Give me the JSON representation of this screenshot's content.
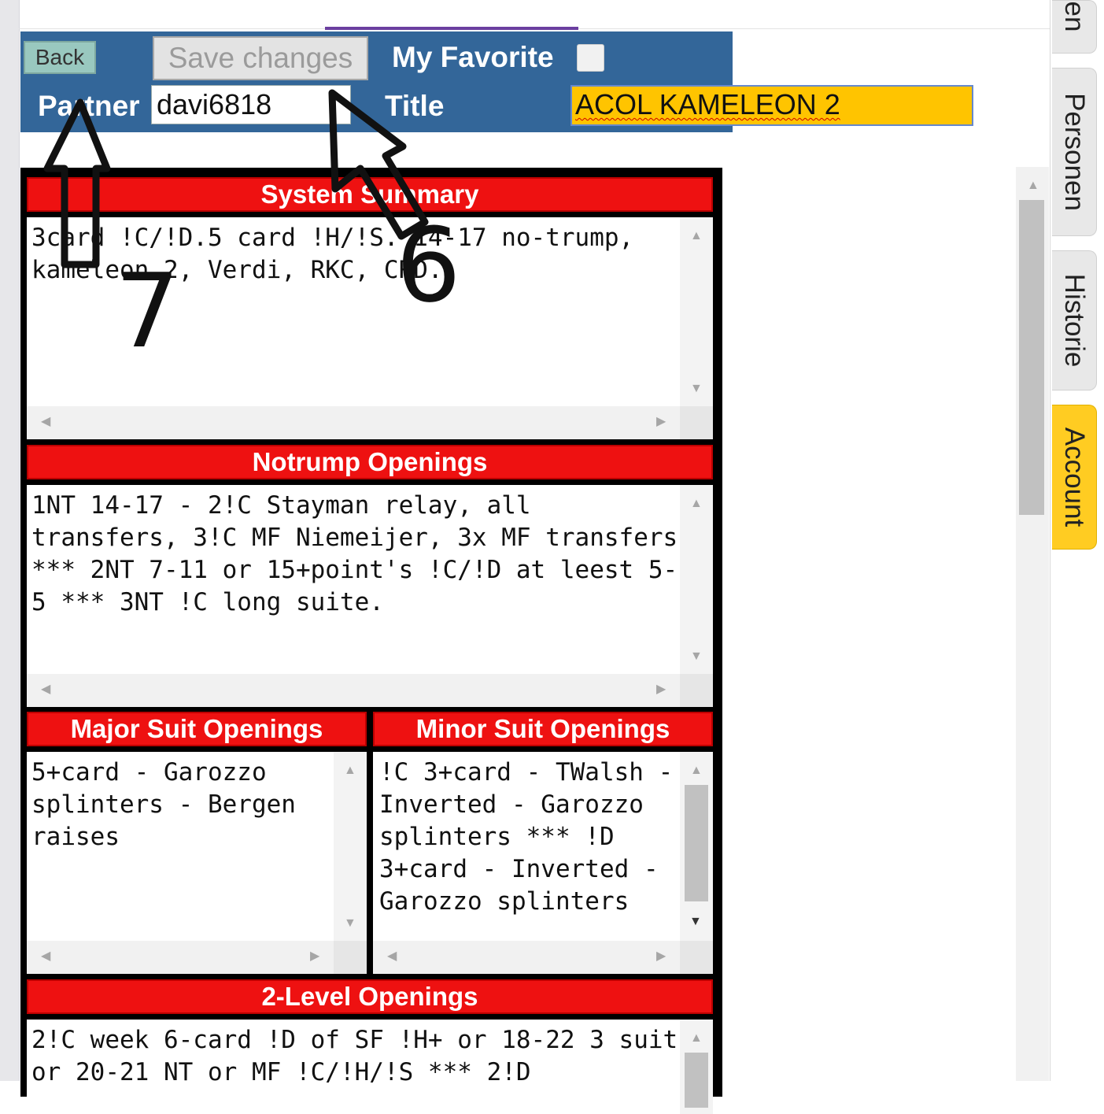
{
  "header": {
    "back_label": "Back",
    "save_label": "Save changes",
    "favorite_label": "My Favorite",
    "favorite_checked": false,
    "partner_label": "Partner",
    "partner_value": "davi6818",
    "title_label": "Title",
    "title_value": "ACOL KAMELEON 2"
  },
  "sections": {
    "system_summary": {
      "heading": "System Summary",
      "text": "3card !C/!D.5 card !H/!S. 14-17 no-trump, kameleon 2, Verdi, RKC, CRD."
    },
    "notrump": {
      "heading": "Notrump Openings",
      "text": "1NT 14-17 - 2!C Stayman relay, all transfers, 3!C MF Niemeijer, 3x MF transfers *** 2NT 7-11 or 15+point's !C/!D at leest 5-5 *** 3NT !C long suite."
    },
    "major": {
      "heading": "Major Suit Openings",
      "text": "5+card - Garozzo splinters - Bergen raises"
    },
    "minor": {
      "heading": "Minor Suit Openings",
      "text": "!C 3+card - TWalsh - Inverted - Garozzo splinters *** !D 3+card - Inverted - Garozzo splinters"
    },
    "two_level": {
      "heading": "2-Level Openings",
      "text": "2!C week 6-card !D of SF !H+ or 18-22 3 suit or 20-21 NT or MF !C/!H/!S *** 2!D"
    }
  },
  "side_tabs": [
    {
      "label": "en",
      "active": false
    },
    {
      "label": "Personen",
      "active": false
    },
    {
      "label": "Historie",
      "active": false
    },
    {
      "label": "Account",
      "active": true
    }
  ],
  "annotations": {
    "marker_6": "6",
    "marker_7": "7"
  },
  "colors": {
    "header_bg": "#336699",
    "section_red": "#ee1111",
    "title_highlight": "#ffc400",
    "active_tab": "#ffcc22"
  }
}
